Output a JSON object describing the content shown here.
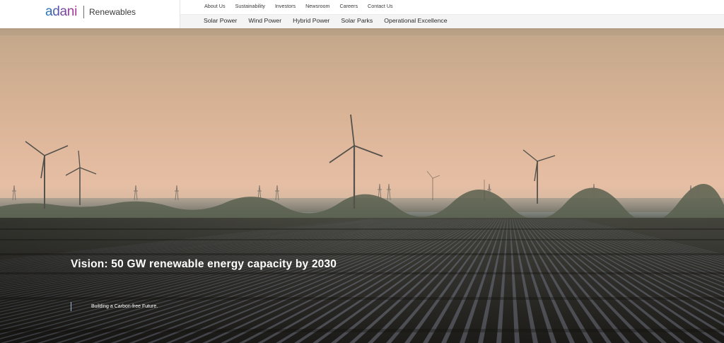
{
  "brand": {
    "name": "adani",
    "division": "Renewables"
  },
  "top_nav": {
    "items": [
      {
        "label": "About Us"
      },
      {
        "label": "Sustainability"
      },
      {
        "label": "Investors"
      },
      {
        "label": "Newsroom"
      },
      {
        "label": "Careers"
      },
      {
        "label": "Contact Us"
      }
    ]
  },
  "main_nav": {
    "items": [
      {
        "label": "Solar Power"
      },
      {
        "label": "Wind Power"
      },
      {
        "label": "Hybrid Power"
      },
      {
        "label": "Solar Parks"
      },
      {
        "label": "Operational Excellence"
      }
    ]
  },
  "hero": {
    "title": "Vision: 50 GW renewable energy capacity by 2030",
    "subtitle": "Building a Carbon-free Future."
  },
  "colors": {
    "sky_top": "#c4a98b",
    "sky_horizon": "#e5bca3",
    "ground": "#2b2a26",
    "accent_bar": "#9bb2d1"
  }
}
